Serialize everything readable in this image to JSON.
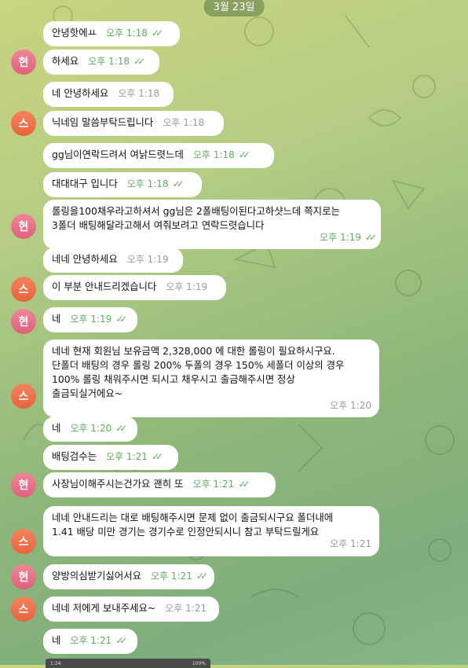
{
  "date_pill": "3월 23일",
  "messages": [
    {
      "text": "안녕핫에ㅛ",
      "time": "오후 1:18",
      "out": true
    },
    {
      "text": "하세요",
      "time": "오후 1:18",
      "out": true,
      "avatar": "현"
    },
    {
      "text": "네 안녕하세요",
      "time": "오후 1:18",
      "out": false
    },
    {
      "text": "닉네임 말씀부탁드립니다",
      "time": "오후 1:18",
      "out": false,
      "avatar": "스"
    },
    {
      "text": "gg님이연락드려서 여낡드렷느데",
      "time": "오후 1:18",
      "out": true
    },
    {
      "text": "대대대구 입니다",
      "time": "오후 1:18",
      "out": true
    },
    {
      "text": "롤링을100채우라고하셔서 gg님은 2폴배팅이된다고하샷느데 쪽지로는\n3폴더 배팅해달라고해서 여줘보려고 연락드렷습니다",
      "time": "오후 1:19",
      "out": true,
      "avatar": "현"
    },
    {
      "text": "네네 안녕하세요",
      "time": "오후 1:19",
      "out": false
    },
    {
      "text": "이 부분 안내드리겠습니다",
      "time": "오후 1:19",
      "out": false,
      "avatar": "스"
    },
    {
      "text": "네",
      "time": "오후 1:19",
      "out": true,
      "avatar": "현"
    },
    {
      "text": "네네 현재 회원님 보유금액 2,328,000 에 대한 롤링이 필요하시구요.\n단폴더 배팅의 경우 롤링 200% 두폴의 경우 150% 세폴더 이상의 경우\n100% 롤링 채워주시면 되시고 채우시고 출금해주시면 정상\n출금되실거에요~",
      "time": "오후 1:20",
      "out": false,
      "avatar": "스"
    },
    {
      "text": "네",
      "time": "오후 1:20",
      "out": true
    },
    {
      "text": "배팅검수는",
      "time": "오후 1:21",
      "out": true
    },
    {
      "text": "사장님이해주시는건가요 괜히 또",
      "time": "오후 1:21",
      "out": true,
      "avatar": "현"
    },
    {
      "text": "네네 안내드리는 대로 배팅해주시면 문제 없이 출금되시구요 폴더내에\n1.41 배당 미만 경기는 경기수로 인정안되시니 참고 부탁드릴게요",
      "time": "오후 1:21",
      "out": false,
      "avatar": "스"
    },
    {
      "text": "양방의심받기싫어서요",
      "time": "오후 1:21",
      "out": true,
      "avatar": "현"
    },
    {
      "text": "네네 저에게 보내주세요~",
      "time": "오후 1:21",
      "out": false,
      "avatar": "스"
    },
    {
      "text": "네",
      "time": "오후 1:21",
      "out": true
    }
  ],
  "status_bar": {
    "left": "1:24",
    "right": "100%"
  },
  "colors": {
    "out_time": "#5fae5f",
    "in_time": "#9a9a9a",
    "avatar_h": "#e96f88",
    "avatar_s": "#ee7048"
  }
}
